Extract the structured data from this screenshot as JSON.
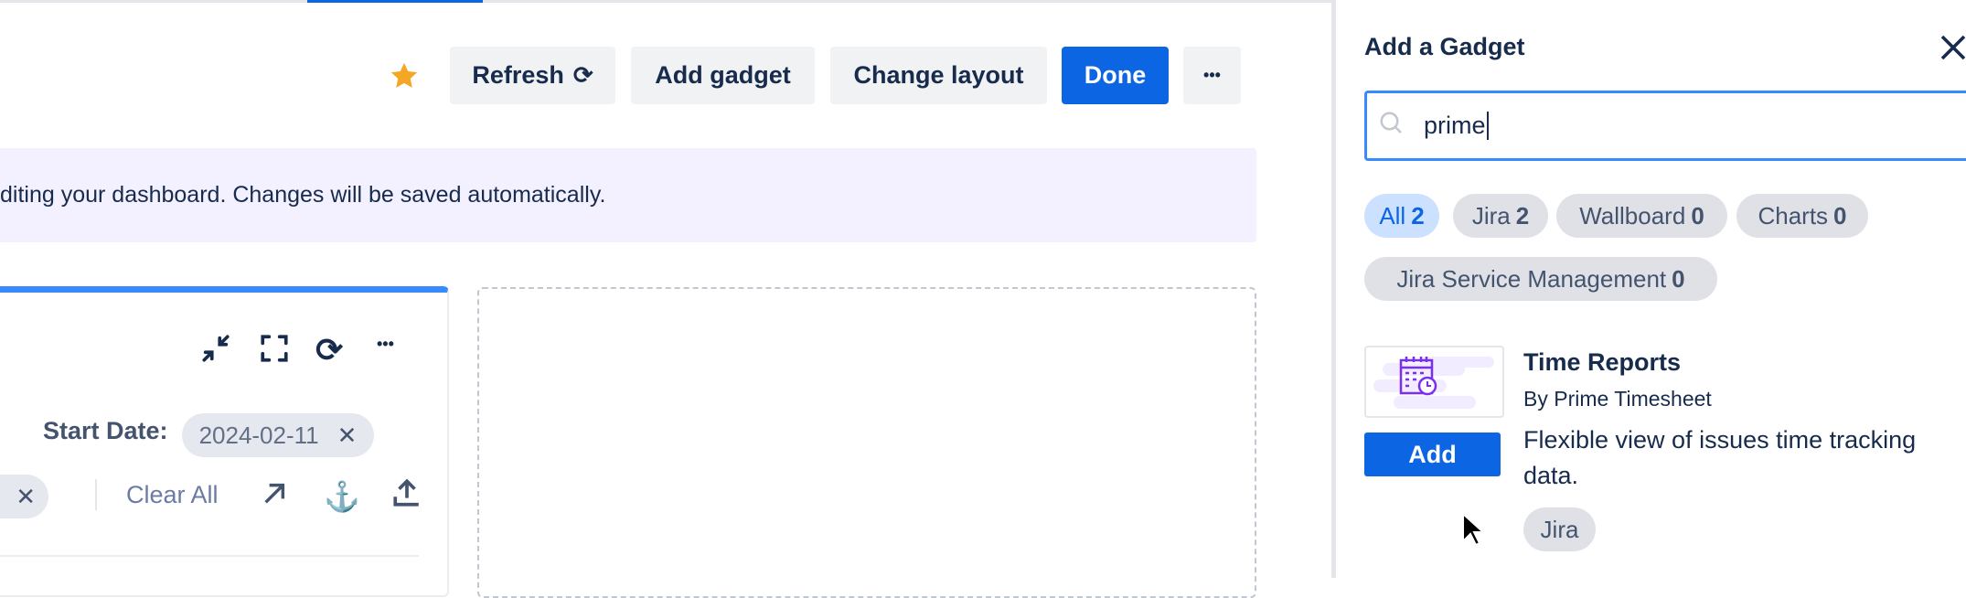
{
  "toolbar": {
    "refresh": "Refresh",
    "add_gadget": "Add gadget",
    "change_layout": "Change layout",
    "done": "Done",
    "more": "•••",
    "star_color": "#f5a623"
  },
  "banner": {
    "text": "diting your dashboard. Changes will be saved automatically."
  },
  "gadget": {
    "start_date_label": "Start Date:",
    "start_date_value": "2024-02-11",
    "clear_all": "Clear All",
    "more": "•••"
  },
  "panel": {
    "title": "Add a Gadget",
    "search": {
      "value": "prime",
      "placeholder": ""
    },
    "filters": [
      {
        "label": "All",
        "count": "2",
        "selected": true
      },
      {
        "label": "Jira",
        "count": "2"
      },
      {
        "label": "Wallboard",
        "count": "0"
      },
      {
        "label": "Charts",
        "count": "0"
      },
      {
        "label": "Jira Service Management",
        "count": "0"
      }
    ],
    "results": [
      {
        "title": "Time Reports",
        "by": "By Prime Timesheet",
        "description": "Flexible view of issues time tracking data.",
        "add": "Add",
        "tag": "Jira"
      }
    ]
  },
  "colors": {
    "accent": "#0c66e4",
    "banner_bg": "#f3f0ff"
  }
}
